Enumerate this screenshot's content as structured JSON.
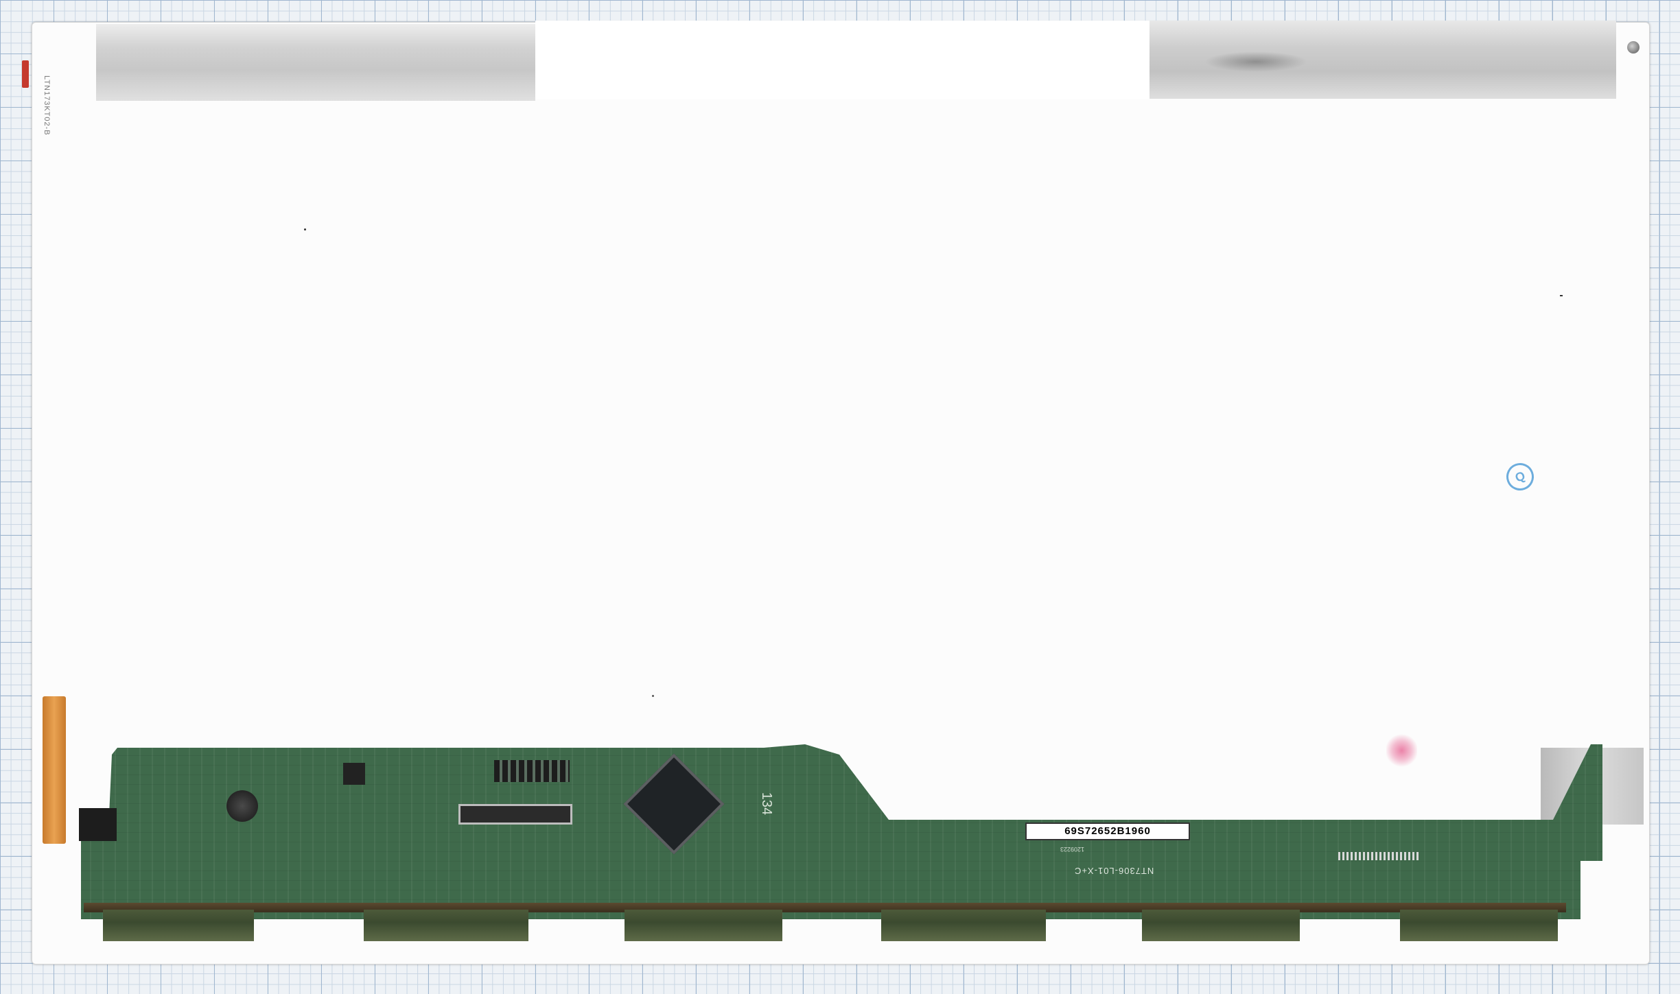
{
  "photo": {
    "subject": "",
    "side_print": "LTN173KT02-B",
    "barcode_label": "69S72652B1960",
    "model_print": "NT7306-L01-X+C",
    "date_print": "1209223",
    "pcb_silk": "134",
    "stamp": "Q",
    "colors": {
      "pcb_green": "#3f6a4b",
      "grid_blue": "#9fb6cf",
      "flex_orange": "#e9a252"
    }
  }
}
